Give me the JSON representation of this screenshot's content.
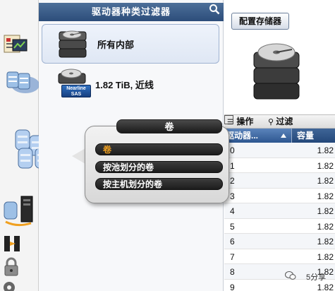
{
  "filter_panel": {
    "title": "驱动器种类过滤器",
    "items": [
      {
        "label": "所有内部"
      },
      {
        "label": "1.82 TiB, 近线",
        "badge": "Nearline SAS"
      }
    ]
  },
  "right": {
    "config_button": "配置存储器",
    "toolbar": {
      "ops_label": "操作",
      "filter_label": "过滤"
    },
    "columns": {
      "name": "驱动器...",
      "capacity": "容量"
    },
    "rows": [
      {
        "id": "0",
        "capacity": "1.82"
      },
      {
        "id": "1",
        "capacity": "1.82"
      },
      {
        "id": "2",
        "capacity": "1.82"
      },
      {
        "id": "3",
        "capacity": "1.82"
      },
      {
        "id": "4",
        "capacity": "1.82"
      },
      {
        "id": "5",
        "capacity": "1.82"
      },
      {
        "id": "6",
        "capacity": "1.82"
      },
      {
        "id": "7",
        "capacity": "1.82"
      },
      {
        "id": "8",
        "capacity": "1.82"
      },
      {
        "id": "9",
        "capacity": "1.82"
      }
    ]
  },
  "popup": {
    "title": "卷",
    "items": [
      "卷",
      "按池划分的卷",
      "按主机划分的卷"
    ]
  },
  "watermark": "5分享",
  "colors": {
    "accent": "#2c4d7a",
    "menu_highlight": "#f0a020"
  }
}
